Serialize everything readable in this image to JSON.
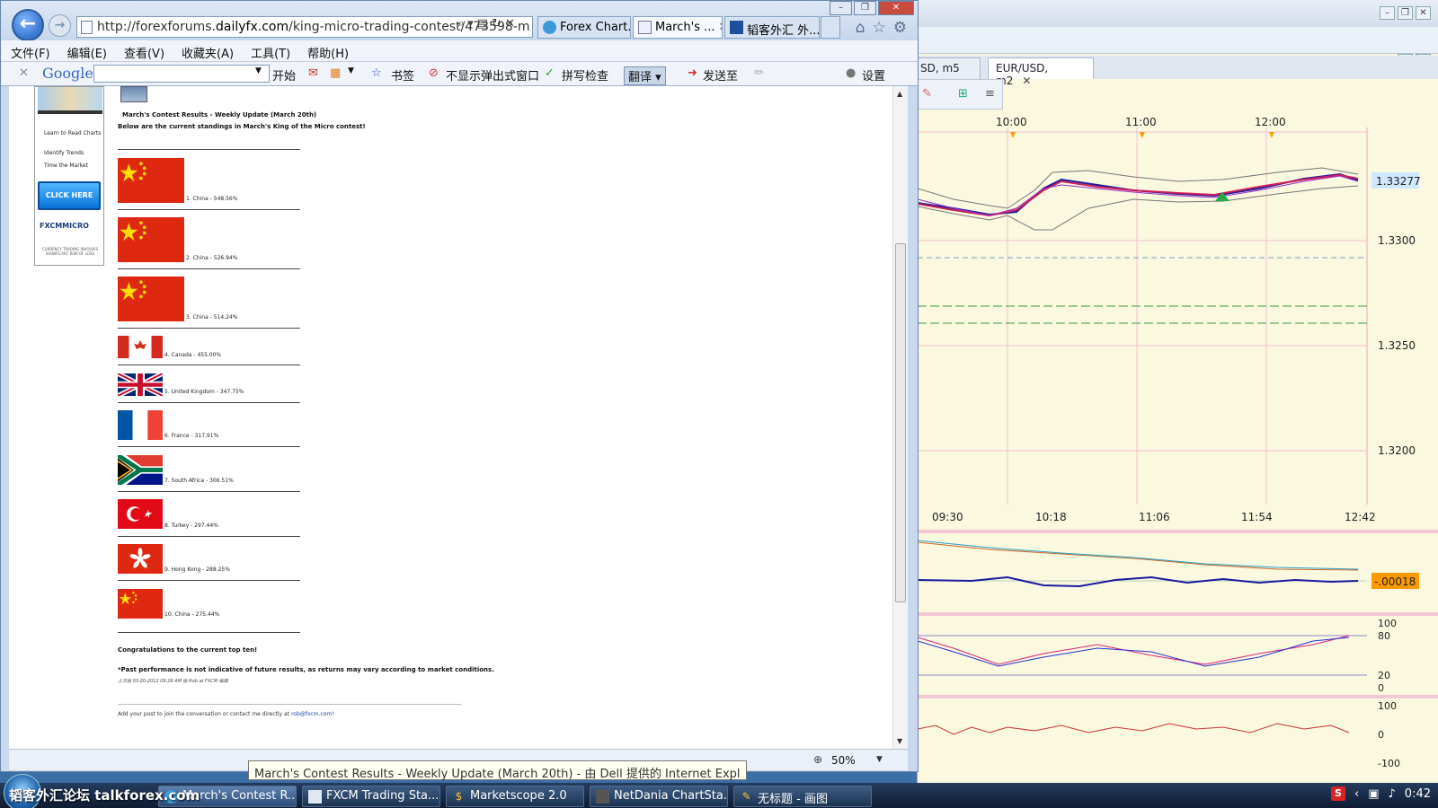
{
  "browser": {
    "url_prefix": "http://forexforums.",
    "url_host": "dailyfx.com",
    "url_path": "/king-micro-trading-contest/473598-m",
    "tabs": [
      {
        "label": "Forex Chart..."
      },
      {
        "label": "March's ..."
      },
      {
        "label": "韬客外汇 外..."
      }
    ],
    "menu": [
      "文件(F)",
      "编辑(E)",
      "查看(V)",
      "收藏夹(A)",
      "工具(T)",
      "帮助(H)"
    ],
    "google_toolbar": {
      "logo": "Google",
      "start": "开始",
      "bookmarks": "书签",
      "popup_blocker": "不显示弹出式窗口",
      "spellcheck": "拼写检查",
      "translate": "翻译",
      "send_to": "发送至",
      "settings": "设置"
    },
    "status": {
      "zoom": "50%"
    },
    "tooltip": "March's Contest Results - Weekly Update (March 20th) - 由 Dell 提供的 Internet Expl"
  },
  "sidebar_ad": {
    "links": [
      "Learn to Read Charts",
      "Identify Trends",
      "Time the Market"
    ],
    "cta": "CLICK HERE",
    "logo": "FXCMMICRO",
    "disclaimer": "CURRENCY TRADING INVOLVES SIGNIFICANT RISK OF LOSS"
  },
  "post": {
    "title": "March's Contest Results - Weekly Update (March 20th)",
    "intro": "Below are the current standings in March's King of the Micro contest!",
    "entries": [
      {
        "text": "1. China - 548.56%",
        "flag": "china"
      },
      {
        "text": "2. China - 526.94%",
        "flag": "china"
      },
      {
        "text": "3. China - 514.24%",
        "flag": "china"
      },
      {
        "text": "4. Canada - 455.00%",
        "flag": "canada"
      },
      {
        "text": "5. United Kingdom - 347.75%",
        "flag": "uk"
      },
      {
        "text": "6. France - 317.91%",
        "flag": "france"
      },
      {
        "text": "7. South Africa - 306.51%",
        "flag": "south-africa"
      },
      {
        "text": "8. Turkey - 297.44%",
        "flag": "turkey"
      },
      {
        "text": "9. Hong Kong - 288.25%",
        "flag": "hong-kong"
      },
      {
        "text": "10. China - 275.44%",
        "flag": "china"
      }
    ],
    "congrats": "Congratulations to the current top ten!",
    "disclaimer": "*Past performance is not indicative of future results, as returns may vary according to market conditions.",
    "edit_note": "上次由 03-20-2012 09:26 AM 由 Rob at FXCM 编辑",
    "reply_note": "Add your post to join the conversation or contact me directly at",
    "reply_email": "rob@fxcm.com!"
  },
  "chart_app": {
    "tabs": [
      {
        "label": "SD, m5"
      },
      {
        "label": "EUR/USD, m2"
      }
    ],
    "time_top": [
      "10:00",
      "11:00",
      "12:00"
    ],
    "time_bottom": [
      "09:30",
      "10:18",
      "11:06",
      "11:54",
      "12:42"
    ],
    "price_labels": [
      "1.3300",
      "1.3250",
      "1.3200"
    ],
    "current_price": "1.33277",
    "macd_value": "-.00018",
    "stoch_labels": [
      "100",
      "80",
      "20",
      "0"
    ],
    "rsi_labels": [
      "100",
      "0",
      "-100"
    ],
    "colors": {
      "price_tag": "#cfe8ff",
      "macd_tag": "#ff9900",
      "panel_bg": "#fbf8e0"
    }
  },
  "taskbar": {
    "watermark": "韬客外汇论坛 talkforex.com",
    "items": [
      {
        "label": "March's Contest R..."
      },
      {
        "label": "FXCM Trading Sta..."
      },
      {
        "label": "Marketscope 2.0"
      },
      {
        "label": "NetDania ChartSta..."
      },
      {
        "label": "无标题 - 画图"
      }
    ],
    "clock": "0:42"
  }
}
